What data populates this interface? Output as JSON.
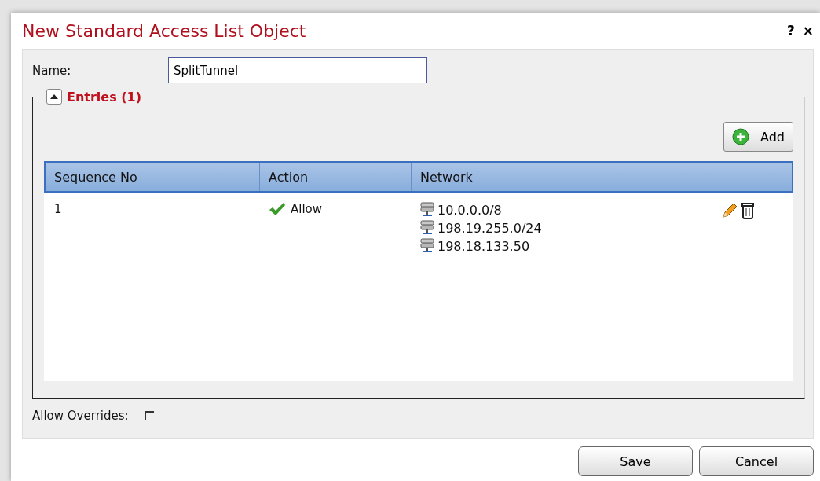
{
  "dialog": {
    "title": "New Standard Access List Object",
    "help": "?",
    "close": "×"
  },
  "name_field": {
    "label": "Name:",
    "value": "SplitTunnel"
  },
  "entries": {
    "title": "Entries (1)",
    "expanded": true,
    "add_button": "Add",
    "table": {
      "columns": [
        "Sequence No",
        "Action",
        "Network"
      ],
      "rows": [
        {
          "sequence": "1",
          "action": "Allow",
          "networks": [
            "10.0.0.0/8",
            "198.19.255.0/24",
            "198.18.133.50"
          ]
        }
      ]
    }
  },
  "allow_overrides": {
    "label": "Allow Overrides:",
    "checked": false
  },
  "buttons": [
    "Save",
    "Cancel"
  ]
}
